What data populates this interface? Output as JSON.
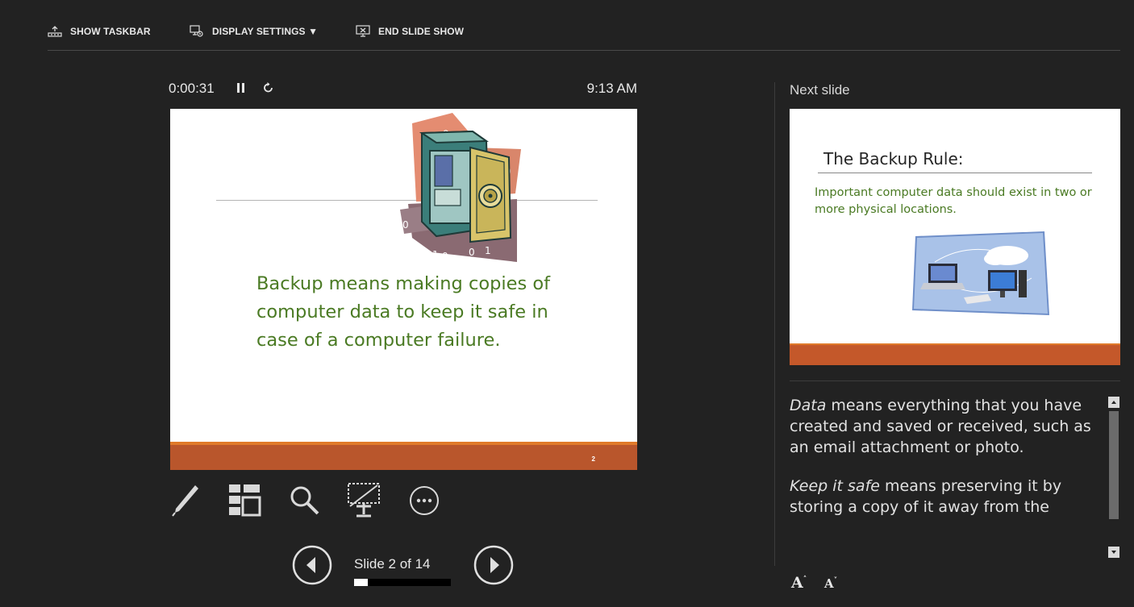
{
  "toolbar": {
    "show_taskbar": "SHOW TASKBAR",
    "display_settings": "DISPLAY SETTINGS ▼",
    "end_slide_show": "END SLIDE SHOW"
  },
  "presenter": {
    "timer": "0:00:31",
    "clock": "9:13 AM",
    "slide_counter": "Slide 2 of 14",
    "progress_fraction": 0.14
  },
  "current_slide": {
    "body": "Backup means making copies of computer data to keep it safe in case of a computer failure.",
    "number": "2",
    "image_digits": [
      "0",
      "1",
      "0",
      "0",
      "0",
      "0",
      "1",
      "0",
      "0",
      "1"
    ]
  },
  "next_slide": {
    "label": "Next slide",
    "title": "The Backup Rule:",
    "text": "Important computer data should exist in two or more physical locations."
  },
  "notes": {
    "p1_em": "Data",
    "p1_rest": " means everything that you have created and saved or received, such as an email attachment or photo.",
    "p2_em": "Keep it safe",
    "p2_rest": " means preserving it by storing a copy of it away from the"
  },
  "font_controls": {
    "increase": "A",
    "decrease": "A"
  },
  "colors": {
    "background": "#222222",
    "slide_text_green": "#4a7a23",
    "slide_band_orange": "#b9562c"
  }
}
